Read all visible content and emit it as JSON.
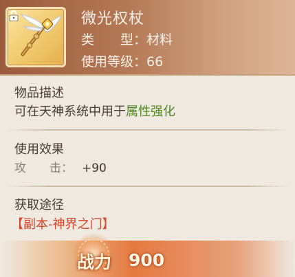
{
  "item": {
    "name": "微光权杖",
    "type_label": "类　　型",
    "type_sep": "：",
    "type_value": "材料",
    "level_label": "使用等级",
    "level_sep": "：",
    "level_value": "66",
    "icon": "winged-scepter-icon",
    "locked_icon": "lock-icon"
  },
  "description": {
    "title": "物品描述",
    "text_prefix": "可在天神系统中用于",
    "text_highlight": "属性强化"
  },
  "effect": {
    "title": "使用效果",
    "attr_label": "攻　　击",
    "attr_sep": "：",
    "attr_value": "+90"
  },
  "source": {
    "title": "获取途径",
    "link": "【副本-神界之门】"
  },
  "power": {
    "label": "战力",
    "value": "900"
  },
  "colors": {
    "highlight_green": "#4e8a1f",
    "link_red": "#d2462b",
    "header_brown": "#9a5b3c",
    "power_orange": "#e26624"
  }
}
